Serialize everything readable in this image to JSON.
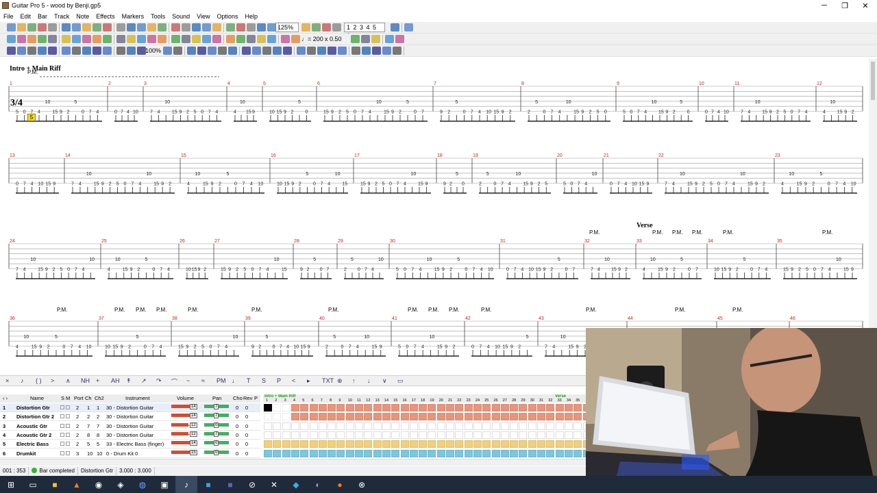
{
  "window": {
    "title": "Guitar Pro 5 - wood by Benji.gp5"
  },
  "menu": [
    "File",
    "Edit",
    "Bar",
    "Track",
    "Note",
    "Effects",
    "Markers",
    "Tools",
    "Sound",
    "View",
    "Options",
    "Help"
  ],
  "toolbar": {
    "zoom": "125%",
    "pages": "1 2 3 4 5 6",
    "tempo": "♩= 200",
    "speed": "x 0.50",
    "percent": "100%"
  },
  "score": {
    "systems": [
      {
        "section": "Intro + Main Riff",
        "time_signature": "3/4",
        "pm": [
          "P.M."
        ],
        "bars": [
          "1",
          "2",
          "3",
          "4",
          "5",
          "6",
          "7",
          "8",
          "9",
          "10",
          "11",
          "12"
        ]
      },
      {
        "bars": [
          "13",
          "14",
          "15",
          "16",
          "17",
          "18",
          "19",
          "20",
          "21",
          "22",
          "23"
        ]
      },
      {
        "section": "Verse",
        "pm": [
          "P.M.",
          "P.M.",
          "P.M.",
          "P.M.",
          "P.M.",
          "P.M."
        ],
        "bars": [
          "24",
          "25",
          "26",
          "27",
          "28",
          "29",
          "30",
          "31",
          "32",
          "33",
          "34",
          "35"
        ]
      },
      {
        "pm": [
          "P.M.",
          "P.M.",
          "P.M.",
          "P.M.",
          "P.M.",
          "P.M.",
          "P.M.",
          "P.M.",
          "P.M.",
          "P.M.",
          "P.M.",
          "P.M.",
          "P.M.",
          "P.M."
        ],
        "bars": [
          "36",
          "37",
          "38",
          "39",
          "40",
          "41",
          "42",
          "43",
          "44",
          "45",
          "46"
        ]
      }
    ],
    "cursor_fret": "5"
  },
  "tracks": {
    "headers": [
      "Name",
      "S",
      "M",
      "Port",
      "Ch",
      "Ch2",
      "Instrument",
      "Volume",
      "Pan",
      "Cho",
      "Rev",
      "P"
    ],
    "rows": [
      {
        "num": "1",
        "name": "Distortion Gtr",
        "port": "2",
        "ch": "1",
        "ch2": "1",
        "instrument": "30 - Distortion Guitar",
        "volume": "14",
        "pan": "7",
        "cho": "0",
        "rev": "0",
        "vol_level": 0.82
      },
      {
        "num": "2",
        "name": "Distortion Gtr 2",
        "port": "2",
        "ch": "2",
        "ch2": "2",
        "instrument": "30 - Distortion Guitar",
        "volume": "14",
        "pan": "7",
        "cho": "0",
        "rev": "0",
        "vol_level": 0.82
      },
      {
        "num": "3",
        "name": "Acoustic Gtr",
        "port": "2",
        "ch": "7",
        "ch2": "7",
        "instrument": "30 - Distortion Guitar",
        "volume": "12",
        "pan": "0",
        "cho": "0",
        "rev": "0",
        "vol_level": 0.7
      },
      {
        "num": "4",
        "name": "Acoustic Gtr 2",
        "port": "2",
        "ch": "8",
        "ch2": "8",
        "instrument": "30 - Distortion Guitar",
        "volume": "12",
        "pan": "7",
        "cho": "0",
        "rev": "0",
        "vol_level": 0.7
      },
      {
        "num": "5",
        "name": "Electric Bass",
        "port": "2",
        "ch": "5",
        "ch2": "5",
        "instrument": "33 - Electric Bass (finger)",
        "volume": "14",
        "pan": "0",
        "cho": "0",
        "rev": "0",
        "vol_level": 0.82
      },
      {
        "num": "6",
        "name": "Drumkit",
        "port": "3",
        "ch": "10",
        "ch2": "10",
        "instrument": "0 - Drum Kit 0",
        "volume": "15",
        "pan": "0",
        "cho": "0",
        "rev": "0",
        "vol_level": 0.88
      }
    ]
  },
  "sequencer": {
    "markers": [
      "Intro + Main Riff",
      "Verse"
    ],
    "bar_numbers": [
      "1",
      "2",
      "3",
      "4",
      "5",
      "6",
      "7",
      "8",
      "9",
      "10",
      "11",
      "12",
      "13",
      "14",
      "15",
      "16",
      "17",
      "18",
      "19",
      "20",
      "21",
      "22",
      "23",
      "24",
      "25",
      "26",
      "27",
      "28",
      "29",
      "30",
      "31",
      "32",
      "33",
      "34",
      "35"
    ],
    "colors": [
      "#e8957c",
      "#e8957c",
      "#ffffff",
      "#ffffff",
      "#f2cf7a",
      "#7cc6e0"
    ]
  },
  "status": {
    "position": "001 : 353",
    "state": "Bar completed",
    "track": "Distortion Gtr",
    "timing": "3.000 : 3.000"
  },
  "colors": {
    "accent": "#d84a2e",
    "playing": "#2fb82f",
    "bass": "#f2cf7a",
    "drum": "#7cc6e0",
    "guitar": "#e8957c"
  }
}
